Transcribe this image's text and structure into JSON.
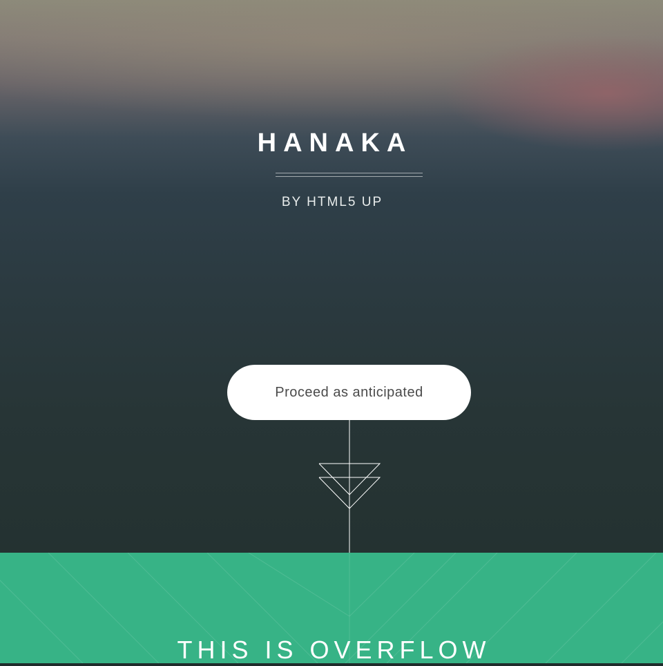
{
  "header": {
    "title": "HANAKA",
    "byline": "BY HTML5 UP"
  },
  "cta": {
    "label": "Proceed as anticipated"
  },
  "icons": {
    "scroll": "double-chevron-down-icon"
  },
  "section": {
    "heading": "THIS IS OVERFLOW"
  },
  "colors": {
    "accent_band": "#37b386",
    "button_bg": "#ffffff",
    "button_text": "#4a4a4a",
    "title_text": "#ffffff"
  }
}
